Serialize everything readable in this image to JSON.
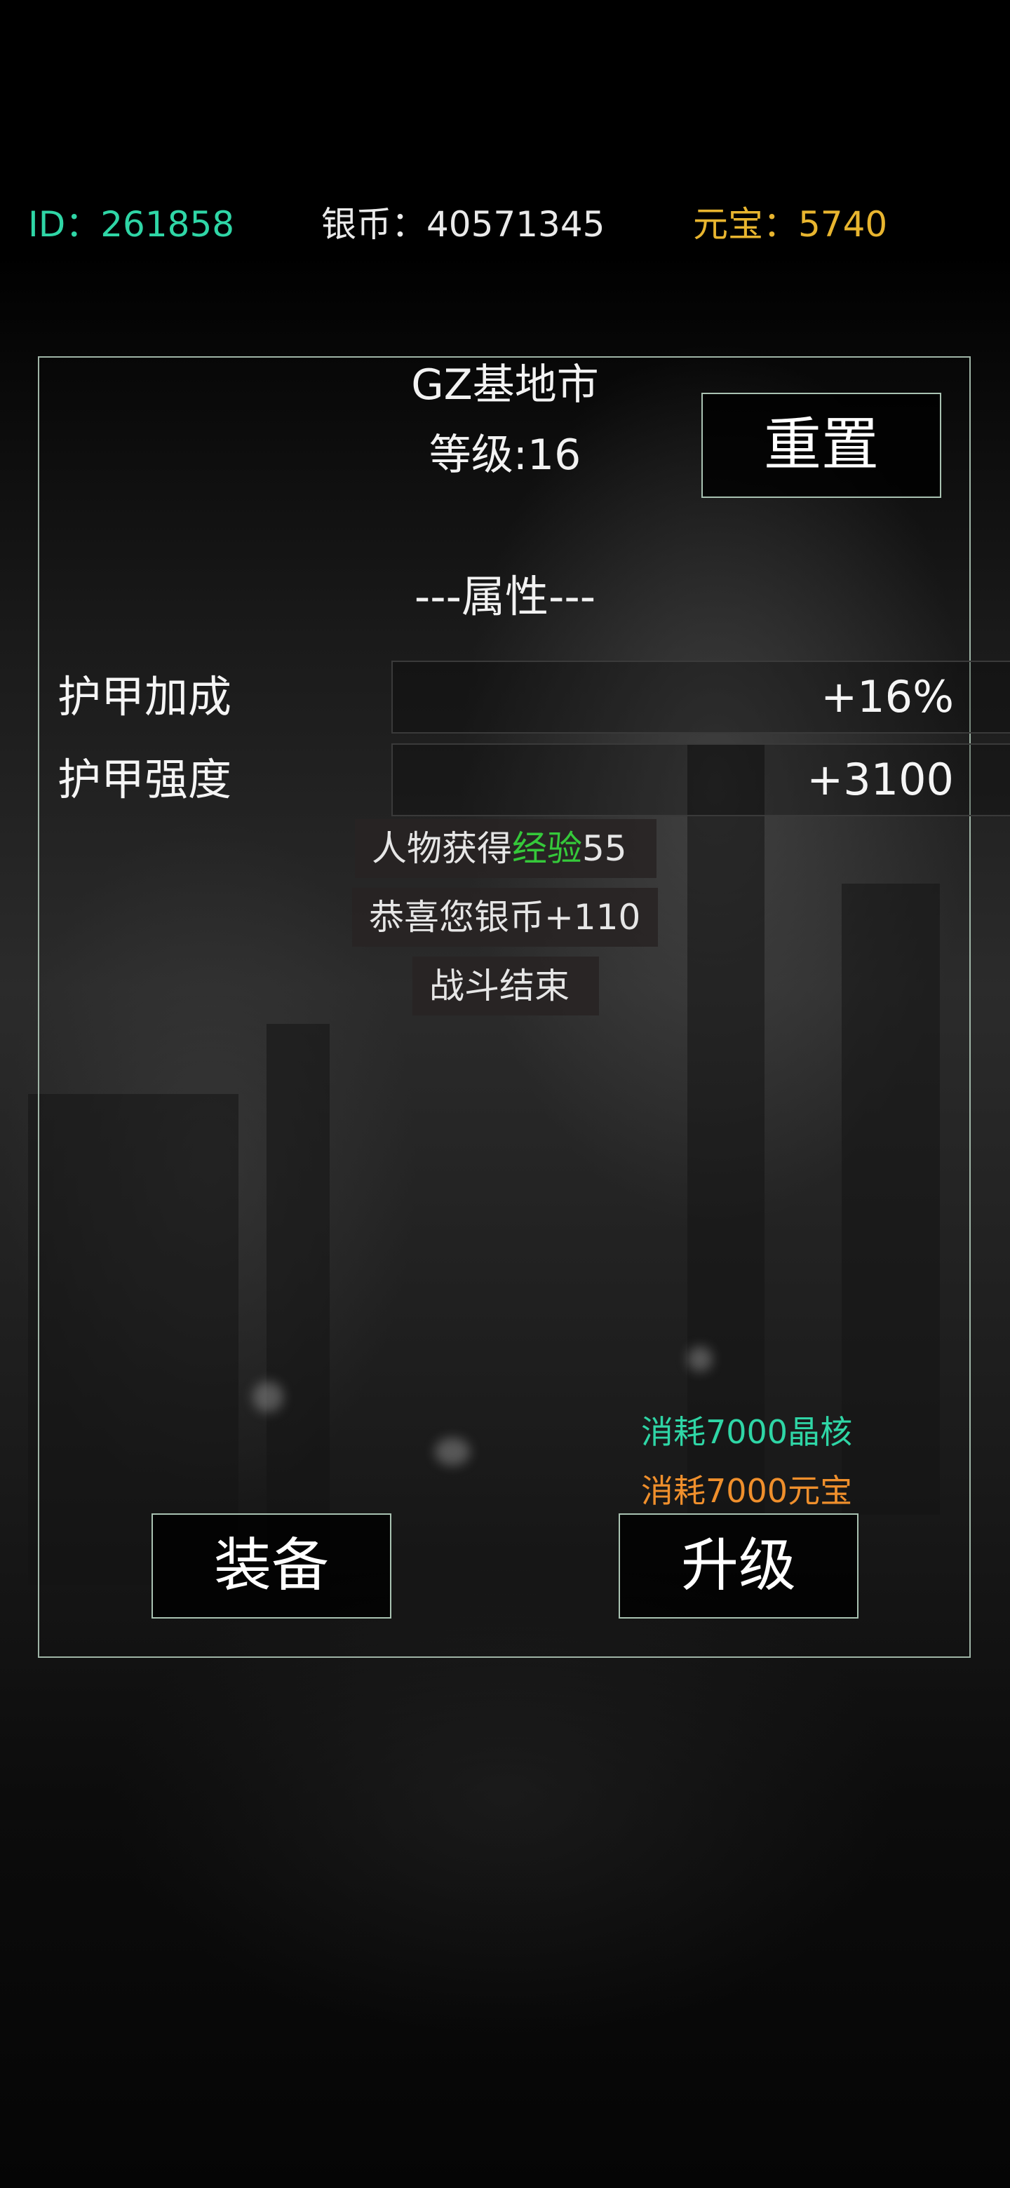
{
  "header": {
    "id_text": "ID：261858",
    "silver_text": "银币：40571345",
    "yuanbao_text": "元宝：5740"
  },
  "city": {
    "name": "GZ基地市",
    "level_text": "等级:16",
    "reset_label": "重置"
  },
  "attributes": {
    "heading": "---属性---",
    "rows": [
      {
        "label": "护甲加成",
        "value": "+16%"
      },
      {
        "label": "护甲强度",
        "value": "+3100"
      }
    ]
  },
  "messages": {
    "exp_prefix": "人物获得",
    "exp_highlight": "经验",
    "exp_amount": "55",
    "silver_msg": "恭喜您银币+110",
    "battle_end": "战斗结束"
  },
  "costs": {
    "crystal": "消耗7000晶核",
    "yuanbao": "消耗7000元宝"
  },
  "buttons": {
    "equip_label": "装备",
    "upgrade_label": "升级"
  },
  "colors": {
    "id": "#2fd6a6",
    "silver": "#eaeaea",
    "yuanbao": "#e8b52f",
    "exp_highlight": "#35c93a",
    "cost_crystal": "#2fd6a6",
    "cost_yuanbao": "#ef8f2c",
    "panel_border": "#9fb4a6"
  }
}
